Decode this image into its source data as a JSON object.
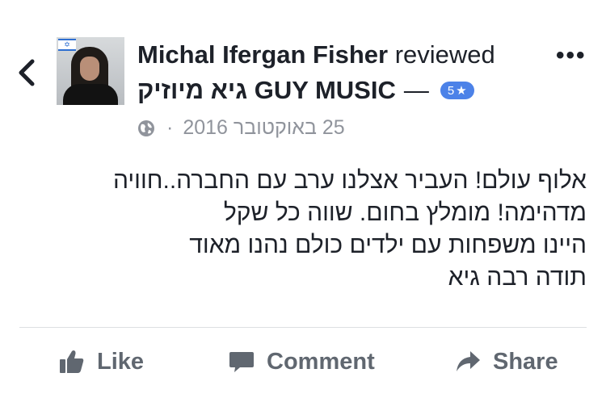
{
  "header": {
    "back_icon": "chevron-left-icon",
    "reviewer_name": "Michal Ifergan Fisher",
    "verb": "reviewed",
    "page_name": "גיא מיוזיק GUY MUSIC",
    "dash": "—",
    "rating": "5",
    "rating_star": "★",
    "more_icon": "more-options-icon",
    "more_text": "•••",
    "date": "25 באוקטובר 2016",
    "separator": "·",
    "privacy_icon": "globe-icon",
    "flag_glyph": "✡"
  },
  "review": {
    "lines": [
      "אלוף עולם! העביר אצלנו ערב עם החברה..חוויה",
      "מדהימה! מומלץ בחום. שווה כל שקל",
      "היינו משפחות עם ילדים כולם נהנו מאוד",
      "תודה רבה גיא"
    ]
  },
  "actions": {
    "like": "Like",
    "comment": "Comment",
    "share": "Share"
  },
  "colors": {
    "text": "#1d2129",
    "secondary": "#90949c",
    "action": "#606770",
    "badge": "#4c82e8",
    "divider": "#dddfe2"
  }
}
